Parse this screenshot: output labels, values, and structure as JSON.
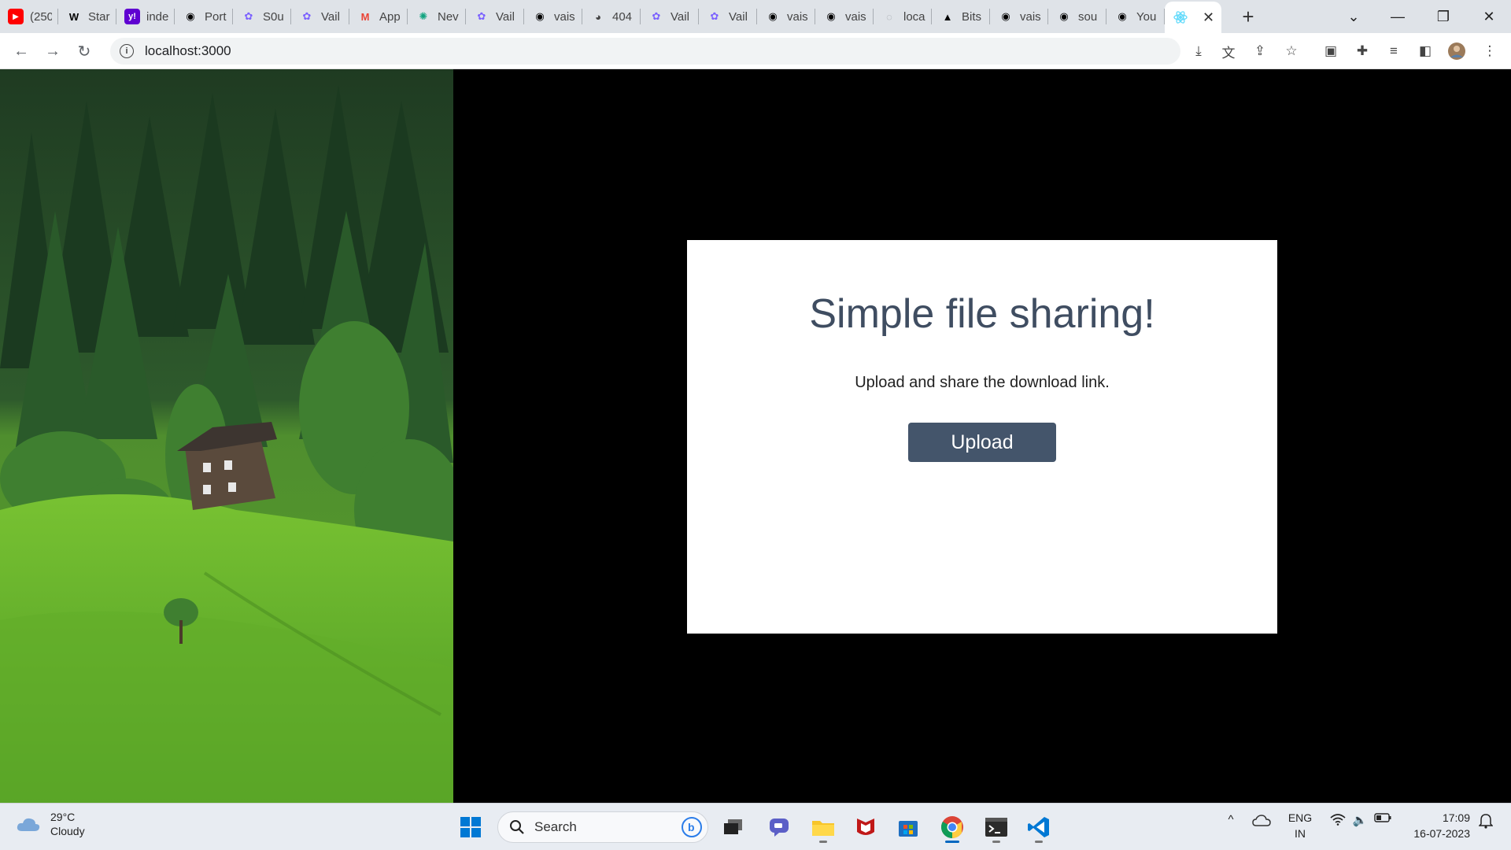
{
  "browser": {
    "tabs": [
      {
        "label": "(250",
        "icon": "youtube-icon",
        "color": "#ff0000"
      },
      {
        "label": "Star",
        "icon": "wikipedia-icon",
        "color": "#000000"
      },
      {
        "label": "inde",
        "icon": "yahoo-icon",
        "color": "#5f01d1"
      },
      {
        "label": "Port",
        "icon": "github-icon",
        "color": "#000000"
      },
      {
        "label": "S0u",
        "icon": "vaibhav-icon",
        "color": "#7b61ff"
      },
      {
        "label": "Vail",
        "icon": "vaibhav-icon",
        "color": "#7b61ff"
      },
      {
        "label": "App",
        "icon": "gmail-icon",
        "color": "#ea4335"
      },
      {
        "label": "Nev",
        "icon": "chatgpt-icon",
        "color": "#10a37f"
      },
      {
        "label": "Vail",
        "icon": "vaibhav-icon",
        "color": "#7b61ff"
      },
      {
        "label": "vais",
        "icon": "github-icon",
        "color": "#000000"
      },
      {
        "label": "404",
        "icon": "globe-icon",
        "color": "#444444"
      },
      {
        "label": "Vail",
        "icon": "vaibhav-icon",
        "color": "#7b61ff"
      },
      {
        "label": "Vail",
        "icon": "vaibhav-icon",
        "color": "#7b61ff"
      },
      {
        "label": "vais",
        "icon": "github-icon",
        "color": "#000000"
      },
      {
        "label": "vais",
        "icon": "github-icon",
        "color": "#000000"
      },
      {
        "label": "loca",
        "icon": "loading-icon",
        "color": "#9aa0a6"
      },
      {
        "label": "Bits",
        "icon": "vercel-icon",
        "color": "#000000"
      },
      {
        "label": "vais",
        "icon": "github-icon",
        "color": "#000000"
      },
      {
        "label": "sou",
        "icon": "github-icon",
        "color": "#000000"
      },
      {
        "label": "You",
        "icon": "github-icon",
        "color": "#000000"
      }
    ],
    "active_tab": {
      "icon": "react-icon",
      "color": "#61dafb"
    },
    "url": "localhost:3000"
  },
  "page": {
    "title": "Simple file sharing!",
    "subtitle": "Upload and share the download link.",
    "upload_label": "Upload",
    "colors": {
      "button": "#44556b",
      "title": "#3f4d61",
      "background": "#000000"
    }
  },
  "taskbar": {
    "weather_temp": "29°C",
    "weather_desc": "Cloudy",
    "search_placeholder": "Search",
    "lang_top": "ENG",
    "lang_bottom": "IN",
    "time": "17:09",
    "date": "16-07-2023"
  }
}
